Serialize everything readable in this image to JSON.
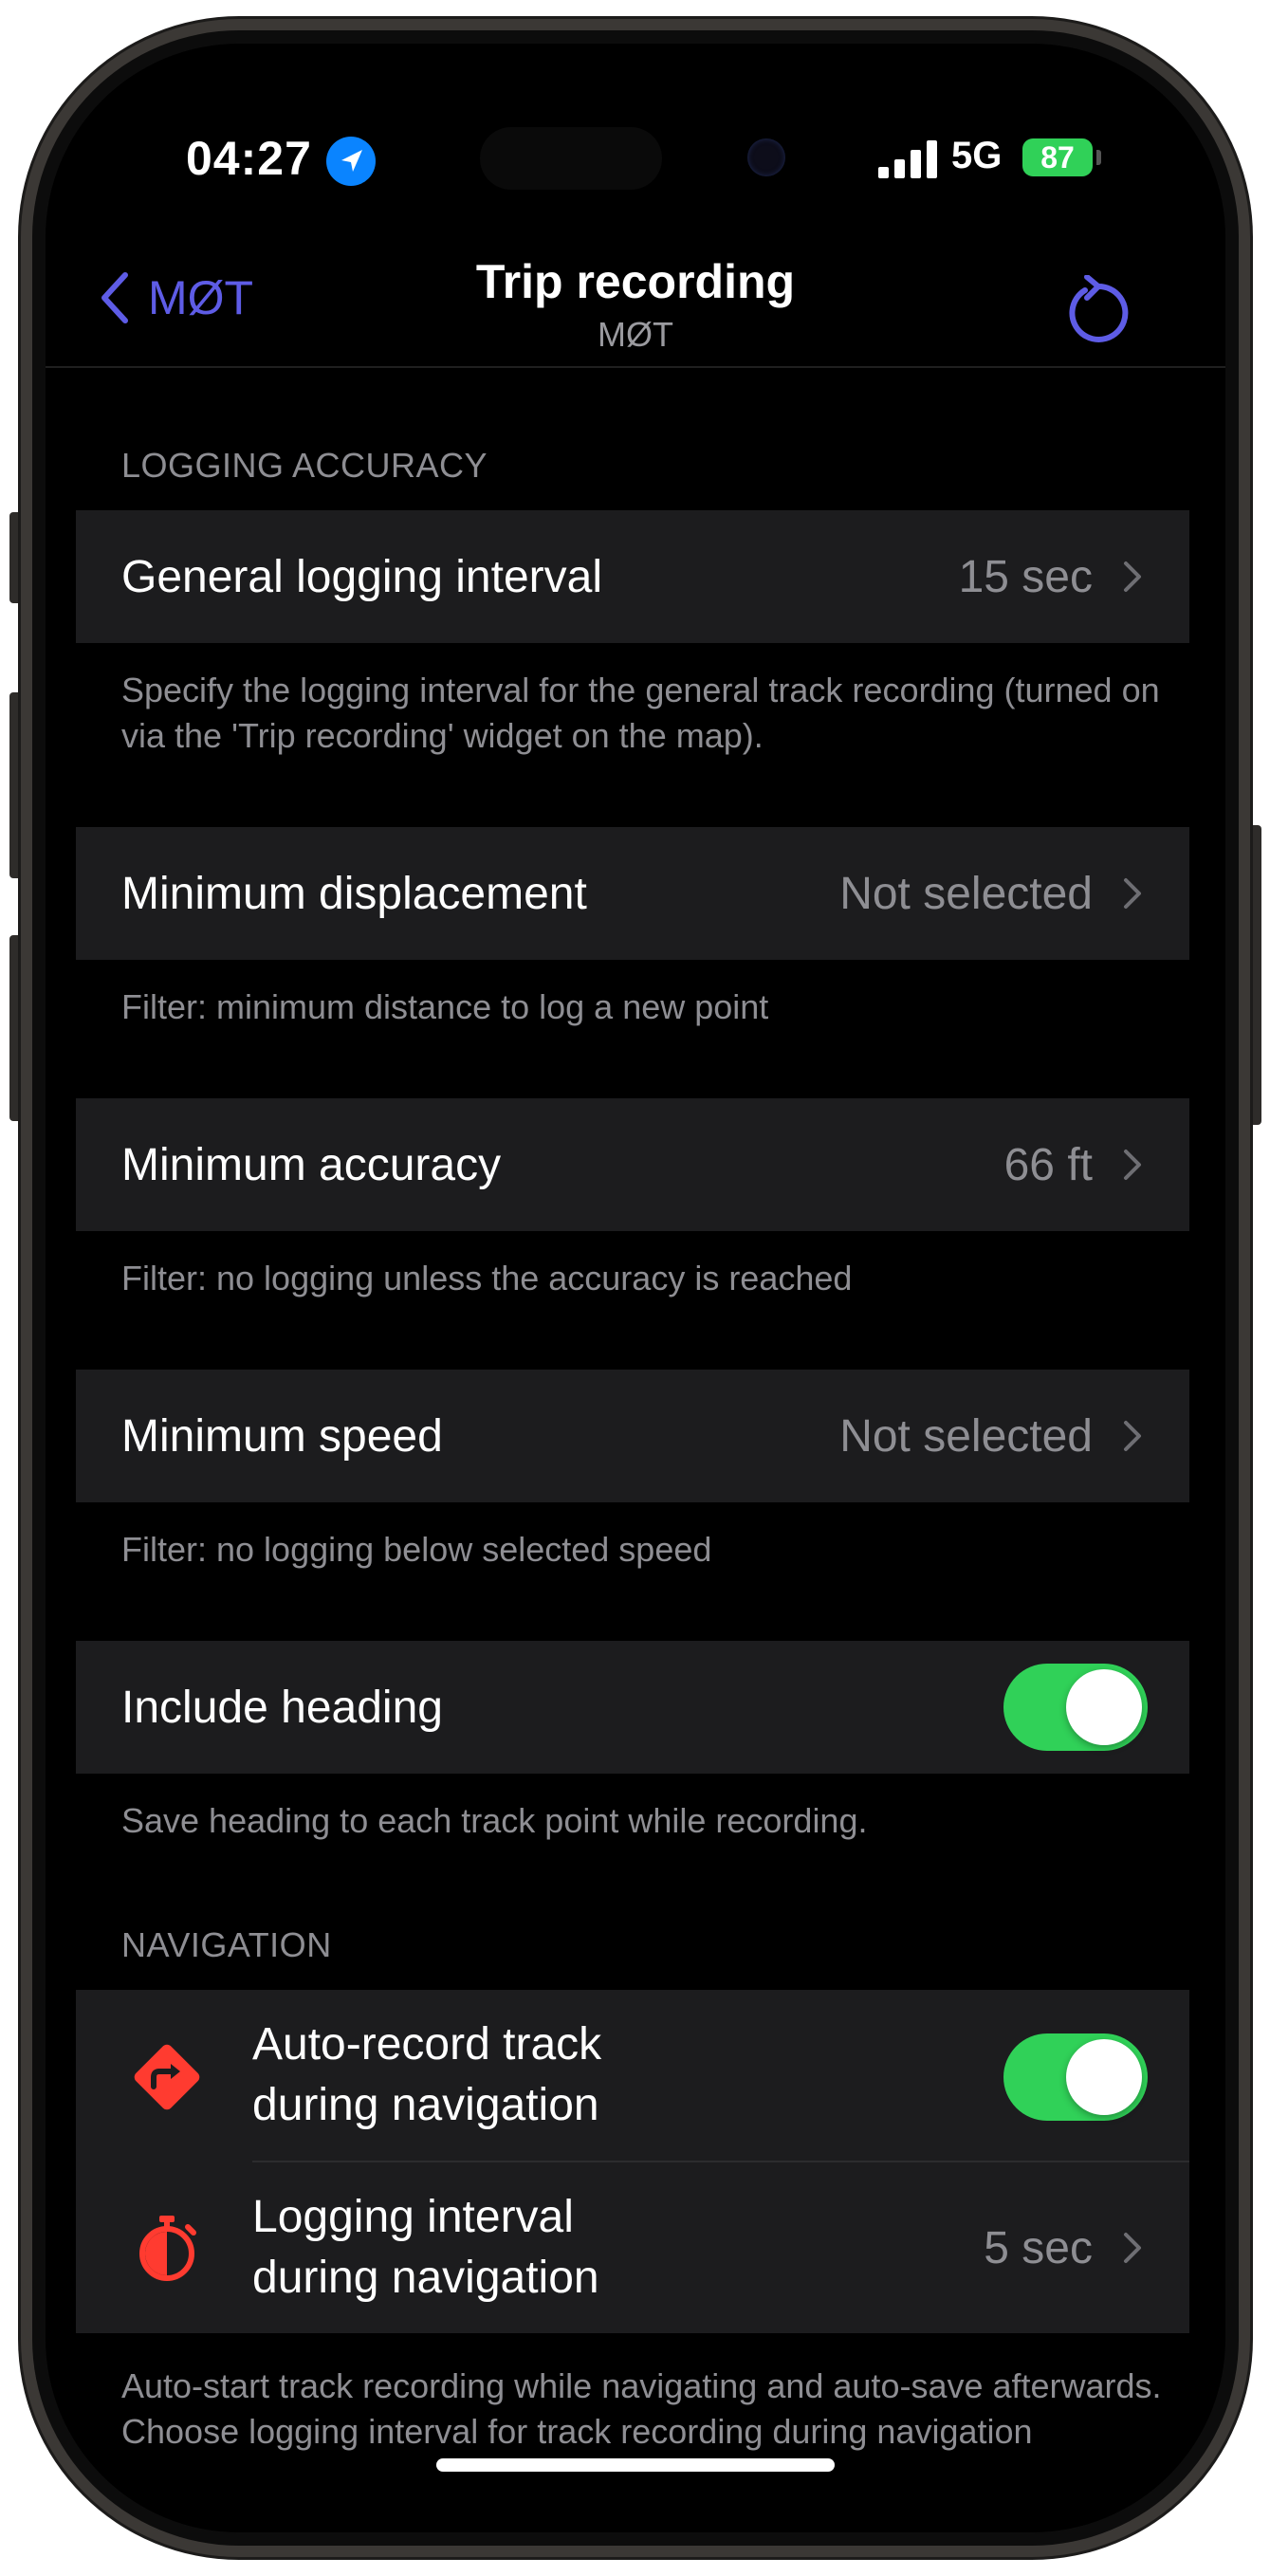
{
  "status_bar": {
    "time": "04:27",
    "network": "5G",
    "battery": "87"
  },
  "nav": {
    "back_label": "MØT",
    "title": "Trip recording",
    "subtitle": "MØT"
  },
  "sections": {
    "logging_accuracy_header": "LOGGING ACCURACY",
    "navigation_header": "NAVIGATION"
  },
  "rows": {
    "general_interval": {
      "label": "General logging interval",
      "value": "15 sec",
      "footer": "Specify the logging interval for the general track recording (turned on via the 'Trip recording' widget on the map)."
    },
    "min_displacement": {
      "label": "Minimum displacement",
      "value": "Not selected",
      "footer": "Filter: minimum distance to log a new point"
    },
    "min_accuracy": {
      "label": "Minimum accuracy",
      "value": "66 ft",
      "footer": "Filter: no logging unless the accuracy is reached"
    },
    "min_speed": {
      "label": "Minimum speed",
      "value": "Not selected",
      "footer": "Filter: no logging below selected speed"
    },
    "include_heading": {
      "label": "Include heading",
      "enabled": true,
      "footer": "Save heading to each track point while recording."
    }
  },
  "navigation": {
    "auto_record": {
      "line1": "Auto-record track",
      "line2": "during navigation",
      "enabled": true,
      "icon": "turn-sign-icon"
    },
    "logging_interval": {
      "line1": "Logging interval",
      "line2": "during navigation",
      "value": "5 sec",
      "icon": "stopwatch-icon"
    },
    "footer": "Auto-start track recording while navigating and auto-save afterwards. Choose logging interval for track recording during navigation"
  },
  "colors": {
    "accent": "#5e5ce6",
    "toggle_on": "#30d158",
    "icon_red": "#ff3b30",
    "cell_bg": "#1c1c1e"
  }
}
